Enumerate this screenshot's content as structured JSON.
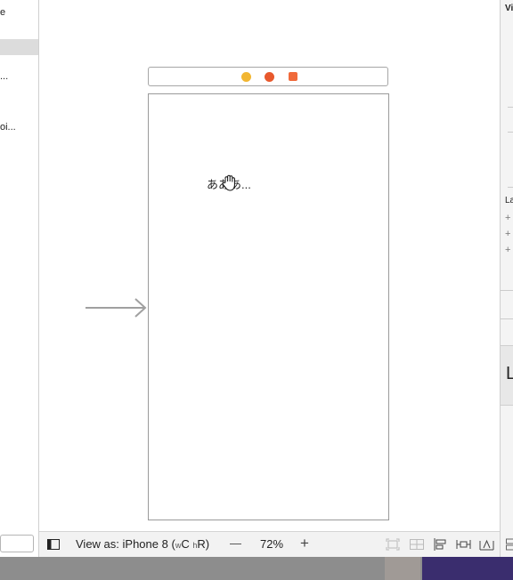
{
  "navigator": {
    "item_1": "e",
    "item_2": "...",
    "item_3": "oi..."
  },
  "scene": {
    "label_text": "あああ..."
  },
  "bottom_bar": {
    "view_as": "View as: iPhone 8",
    "size_class_prefix": "(",
    "size_w": "w",
    "size_w_value": "C",
    "size_h": "h",
    "size_h_value": "R)",
    "zoom_out": "—",
    "zoom": "72%",
    "zoom_in": "+"
  },
  "inspector": {
    "header": "Vi",
    "section": "La",
    "big_letter": "L",
    "plus": "+"
  },
  "colors": {
    "dock_yellow": "#f2b632",
    "dock_red": "#e8592d",
    "dock_orange": "#f06a3b",
    "entry_arrow": "#a0a0a0"
  }
}
